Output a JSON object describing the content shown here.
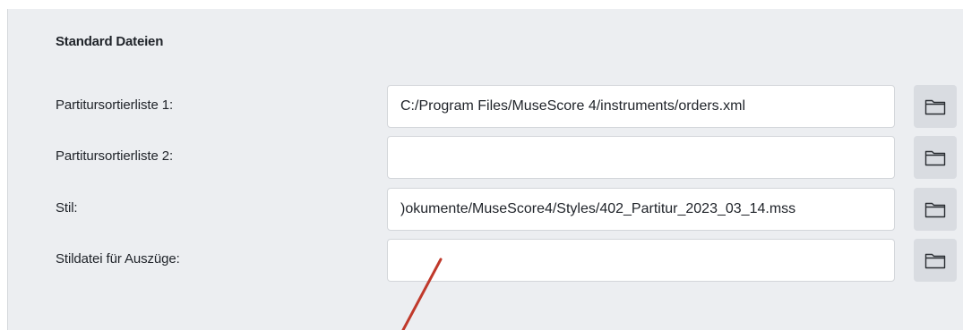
{
  "section": {
    "title": "Standard Dateien"
  },
  "rows": [
    {
      "label": "Partitursortierliste 1:",
      "value": "C:/Program Files/MuseScore 4/instruments/orders.xml",
      "browse_icon": "folder-icon"
    },
    {
      "label": "Partitursortierliste 2:",
      "value": "",
      "browse_icon": "folder-icon"
    },
    {
      "label": "Stil:",
      "value": ")okumente/MuseScore4/Styles/402_Partitur_2023_03_14.mss",
      "browse_icon": "folder-icon"
    },
    {
      "label": "Stildatei für Auszüge:",
      "value": "",
      "browse_icon": "folder-icon"
    }
  ],
  "colors": {
    "panel_background": "#eceef1",
    "input_background": "#ffffff",
    "input_border": "#d3d6da",
    "button_background": "#d9dce1",
    "text": "#1f2329",
    "annotation": "#c0392b"
  }
}
